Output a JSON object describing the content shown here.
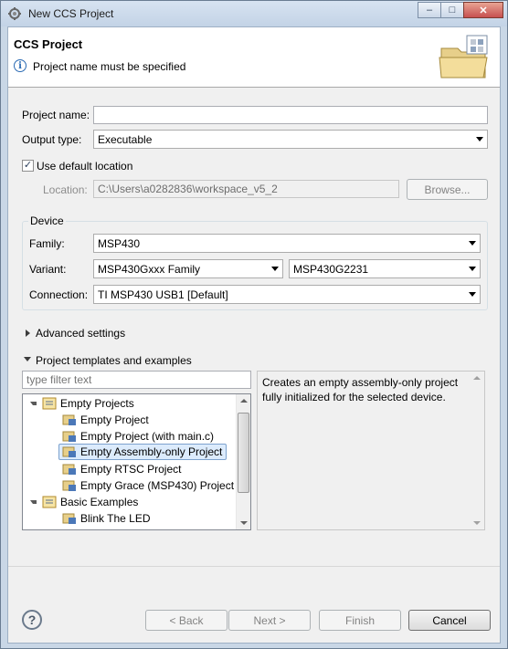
{
  "window": {
    "title": "New CCS Project",
    "controls": {
      "minimize": "–",
      "maximize": "□",
      "close": "✕"
    }
  },
  "header": {
    "title": "CCS Project",
    "message": "Project name must be specified",
    "message_icon": "info-icon"
  },
  "form": {
    "project_name": {
      "label": "Project name:",
      "value": "",
      "placeholder": ""
    },
    "output_type": {
      "label": "Output type:",
      "value": "Executable"
    },
    "default_location": {
      "label": "Use default location",
      "checked": true
    },
    "location": {
      "label": "Location:",
      "value": "C:\\Users\\a0282836\\workspace_v5_2",
      "browse_label": "Browse..."
    }
  },
  "device": {
    "group_title": "Device",
    "family": {
      "label": "Family:",
      "value": "MSP430"
    },
    "variant": {
      "label": "Variant:",
      "filter_value": "MSP430Gxxx Family",
      "value": "MSP430G2231"
    },
    "connection": {
      "label": "Connection:",
      "value": "TI MSP430 USB1 [Default]"
    }
  },
  "advanced": {
    "label": "Advanced settings",
    "expanded": false
  },
  "templates": {
    "label": "Project templates and examples",
    "expanded": true,
    "filter_placeholder": "type filter text",
    "tree": [
      {
        "label": "Empty Projects",
        "type": "folder"
      },
      {
        "label": "Empty Project",
        "type": "project"
      },
      {
        "label": "Empty Project (with main.c)",
        "type": "project"
      },
      {
        "label": "Empty Assembly-only Project",
        "type": "project",
        "selected": true
      },
      {
        "label": "Empty RTSC Project",
        "type": "project"
      },
      {
        "label": "Empty Grace (MSP430) Project",
        "type": "project"
      },
      {
        "label": "Basic Examples",
        "type": "folder"
      },
      {
        "label": "Blink The LED",
        "type": "project"
      }
    ],
    "description": "Creates an empty assembly-only project fully initialized for the selected device."
  },
  "footer": {
    "back_label": "< Back",
    "next_label": "Next >",
    "finish_label": "Finish",
    "cancel_label": "Cancel"
  },
  "colors": {
    "selection_bg": "#dcebfc",
    "selection_border": "#7da2ce",
    "info_blue": "#2a6ab3"
  }
}
